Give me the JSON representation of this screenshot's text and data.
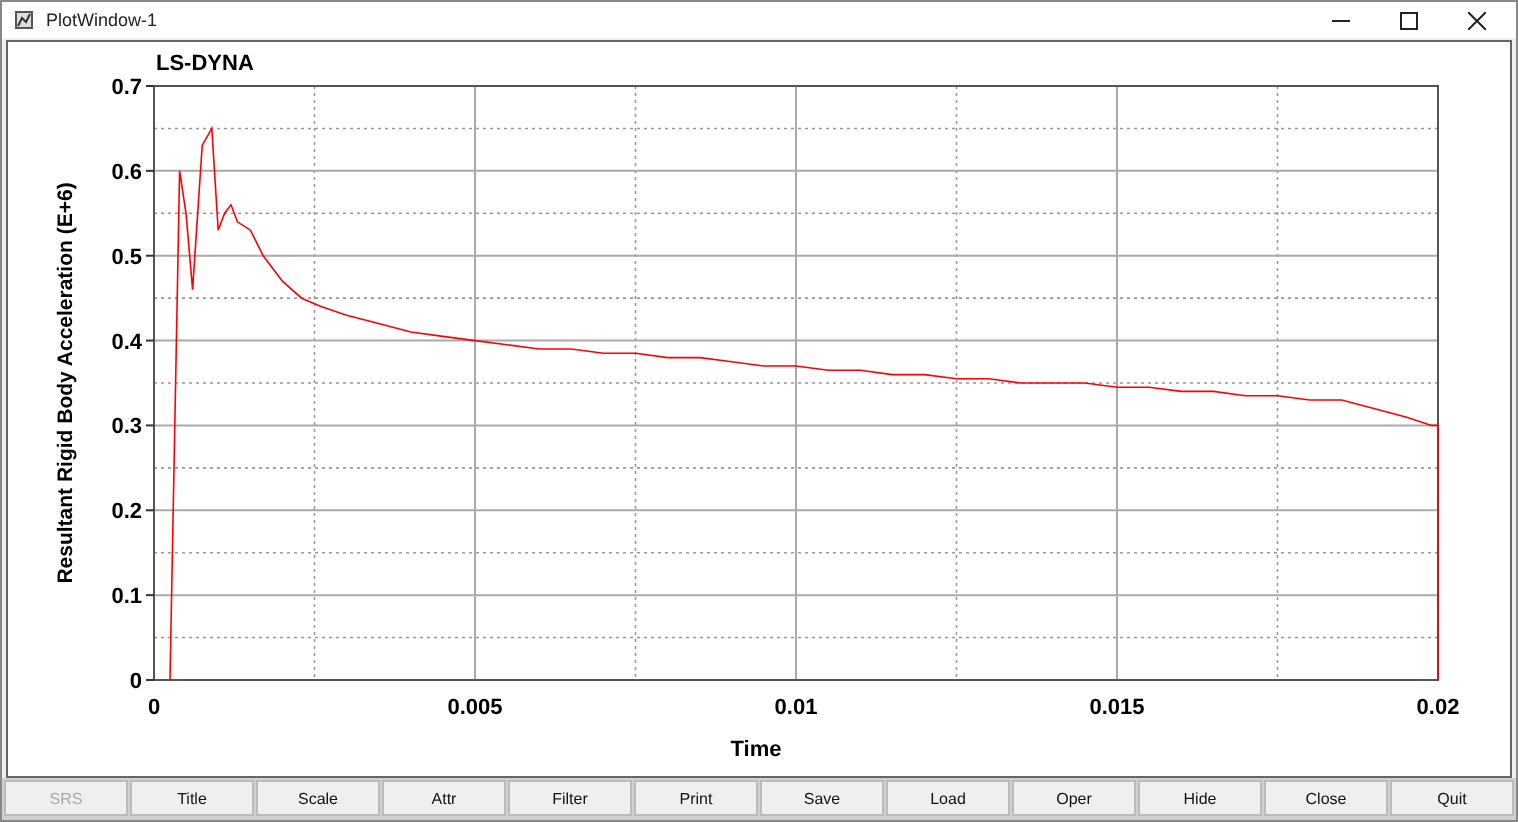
{
  "window": {
    "title": "PlotWindow-1"
  },
  "plot": {
    "title": "LS-DYNA",
    "chart_data": {
      "type": "line",
      "xlabel": "Time",
      "ylabel": "Resultant Rigid Body Acceleration (E+6)",
      "xlim": [
        0,
        0.02
      ],
      "ylim": [
        0,
        0.7
      ],
      "xticks": [
        {
          "value": 0,
          "label": "0"
        },
        {
          "value": 0.005,
          "label": "0.005"
        },
        {
          "value": 0.01,
          "label": "0.01"
        },
        {
          "value": 0.015,
          "label": "0.015"
        },
        {
          "value": 0.02,
          "label": "0.02"
        }
      ],
      "yticks": [
        {
          "value": 0,
          "label": "0"
        },
        {
          "value": 0.1,
          "label": "0.1"
        },
        {
          "value": 0.2,
          "label": "0.2"
        },
        {
          "value": 0.3,
          "label": "0.3"
        },
        {
          "value": 0.4,
          "label": "0.4"
        },
        {
          "value": 0.5,
          "label": "0.5"
        },
        {
          "value": 0.6,
          "label": "0.6"
        },
        {
          "value": 0.7,
          "label": "0.7"
        }
      ],
      "grid": true,
      "x": [
        0.00025,
        0.0004,
        0.0005,
        0.0006,
        0.00075,
        0.0009,
        0.001,
        0.0011,
        0.0012,
        0.0013,
        0.0015,
        0.0017,
        0.002,
        0.0023,
        0.0026,
        0.003,
        0.0035,
        0.004,
        0.0045,
        0.005,
        0.0055,
        0.006,
        0.0065,
        0.007,
        0.0075,
        0.008,
        0.0085,
        0.009,
        0.0095,
        0.01,
        0.0105,
        0.011,
        0.0115,
        0.012,
        0.0125,
        0.013,
        0.0135,
        0.014,
        0.0145,
        0.015,
        0.0155,
        0.016,
        0.0165,
        0.017,
        0.0175,
        0.018,
        0.0185,
        0.019,
        0.0195,
        0.0199,
        0.02,
        0.02
      ],
      "series": [
        {
          "color": "#ff0000",
          "values": [
            0,
            0.6,
            0.55,
            0.46,
            0.63,
            0.65,
            0.53,
            0.55,
            0.56,
            0.54,
            0.53,
            0.5,
            0.47,
            0.45,
            0.44,
            0.43,
            0.42,
            0.41,
            0.405,
            0.4,
            0.395,
            0.39,
            0.39,
            0.385,
            0.385,
            0.38,
            0.38,
            0.375,
            0.37,
            0.37,
            0.365,
            0.365,
            0.36,
            0.36,
            0.355,
            0.355,
            0.35,
            0.35,
            0.35,
            0.345,
            0.345,
            0.34,
            0.34,
            0.335,
            0.335,
            0.33,
            0.33,
            0.32,
            0.31,
            0.3,
            0.3,
            0
          ]
        }
      ]
    }
  },
  "buttons": [
    {
      "label": "SRS",
      "disabled": true
    },
    {
      "label": "Title",
      "disabled": false
    },
    {
      "label": "Scale",
      "disabled": false
    },
    {
      "label": "Attr",
      "disabled": false
    },
    {
      "label": "Filter",
      "disabled": false
    },
    {
      "label": "Print",
      "disabled": false
    },
    {
      "label": "Save",
      "disabled": false
    },
    {
      "label": "Load",
      "disabled": false
    },
    {
      "label": "Oper",
      "disabled": false
    },
    {
      "label": "Hide",
      "disabled": false
    },
    {
      "label": "Close",
      "disabled": false
    },
    {
      "label": "Quit",
      "disabled": false
    }
  ]
}
